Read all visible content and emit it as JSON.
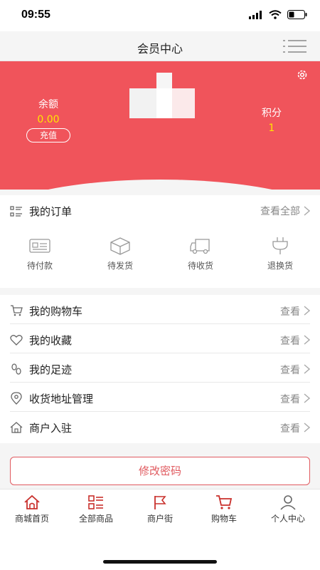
{
  "status_bar": {
    "time": "09:55"
  },
  "header": {
    "title": "会员中心"
  },
  "account": {
    "balance_label": "余额",
    "balance_value": "0.00",
    "recharge_label": "充值",
    "points_label": "积分",
    "points_value": "1"
  },
  "orders": {
    "title": "我的订单",
    "view_all": "查看全部",
    "statuses": [
      {
        "label": "待付款",
        "icon": "wallet-card-icon"
      },
      {
        "label": "待发货",
        "icon": "package-box-icon"
      },
      {
        "label": "待收货",
        "icon": "delivery-truck-icon"
      },
      {
        "label": "退换货",
        "icon": "return-plug-icon"
      }
    ]
  },
  "menu": [
    {
      "label": "我的购物车",
      "action": "查看",
      "icon": "cart-icon"
    },
    {
      "label": "我的收藏",
      "action": "查看",
      "icon": "heart-icon"
    },
    {
      "label": "我的足迹",
      "action": "查看",
      "icon": "footprint-icon"
    },
    {
      "label": "收货地址管理",
      "action": "查看",
      "icon": "location-pin-icon"
    },
    {
      "label": "商户入驻",
      "action": "查看",
      "icon": "home-icon"
    }
  ],
  "change_password_label": "修改密码",
  "tabbar": [
    {
      "label": "商城首页",
      "icon": "home-icon",
      "active": true
    },
    {
      "label": "全部商品",
      "icon": "grid-list-icon",
      "active": false
    },
    {
      "label": "商户街",
      "icon": "flag-icon",
      "active": false
    },
    {
      "label": "购物车",
      "icon": "cart-icon",
      "active": false
    },
    {
      "label": "个人中心",
      "icon": "person-icon",
      "active": false
    }
  ],
  "colors": {
    "brand": "#f0545b",
    "accent_yellow": "#ffe600",
    "active_tab": "#c9302c"
  }
}
